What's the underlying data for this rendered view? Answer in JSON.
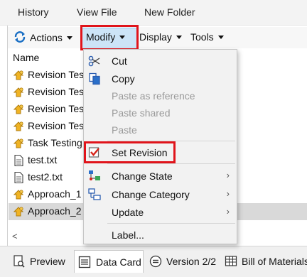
{
  "top_menu": {
    "history": "History",
    "view_file": "View File",
    "new_folder": "New Folder"
  },
  "toolbar": {
    "actions": "Actions",
    "modify": "Modify",
    "display": "Display",
    "tools": "Tools"
  },
  "list": {
    "header": "Name",
    "rows": [
      {
        "label": "Revision Tes",
        "icon": "item-hand-icon",
        "selected": false
      },
      {
        "label": "Revision Tes",
        "icon": "item-hand-icon",
        "selected": false
      },
      {
        "label": "Revision Tes",
        "icon": "item-hand-icon",
        "selected": false
      },
      {
        "label": "Revision Tes",
        "icon": "item-hand-icon",
        "selected": false
      },
      {
        "label": "Task Testing",
        "icon": "item-hand-icon",
        "selected": false
      },
      {
        "label": "test.txt",
        "icon": "document-icon",
        "selected": false
      },
      {
        "label": "test2.txt",
        "icon": "document-icon",
        "selected": false
      },
      {
        "label": "Approach_1",
        "icon": "item-hand-icon",
        "selected": false
      },
      {
        "label": "Approach_2",
        "icon": "item-hand-icon",
        "selected": true
      }
    ]
  },
  "modify_menu": {
    "cut": "Cut",
    "copy": "Copy",
    "paste_as_reference": "Paste as reference",
    "paste_shared": "Paste shared",
    "paste": "Paste",
    "set_revision": "Set Revision",
    "change_state": "Change State",
    "change_category": "Change Category",
    "update": "Update",
    "label": "Label...",
    "submenu_arrow": "›"
  },
  "bottom_tabs": {
    "preview": "Preview",
    "data_card": "Data Card",
    "version": "Version 2/2",
    "bill_of_materials": "Bill of Materials"
  },
  "scroll": {
    "left_arrow": "<"
  },
  "colors": {
    "highlight_red": "#e0141b",
    "selection_blue": "#cce4f7",
    "item_yellow": "#f0b323"
  }
}
